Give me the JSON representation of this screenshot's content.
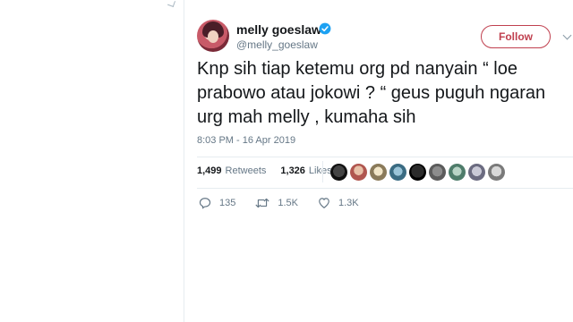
{
  "tweet": {
    "display_name": "melly goeslaw",
    "handle": "@melly_goeslaw",
    "follow_label": "Follow",
    "text": "Knp sih tiap ketemu org pd nanyain “ loe\nprabowo atau jokowi ? “ geus puguh ngaran\nurg mah melly , kumaha sih",
    "timestamp": "8:03 PM - 16 Apr 2019"
  },
  "stats": {
    "retweets_count": "1,499",
    "retweets_label": "Retweets",
    "likes_count": "1,326",
    "likes_label": "Likes"
  },
  "actions": {
    "replies": "135",
    "retweets": "1.5K",
    "likes": "1.3K"
  },
  "colors": {
    "accent": "#c0404f",
    "verified": "#1da1f2",
    "secondary_text": "#657786"
  },
  "icons": [
    "verified-badge-icon",
    "chevron-down-icon",
    "reply-icon",
    "retweet-icon",
    "like-icon"
  ]
}
